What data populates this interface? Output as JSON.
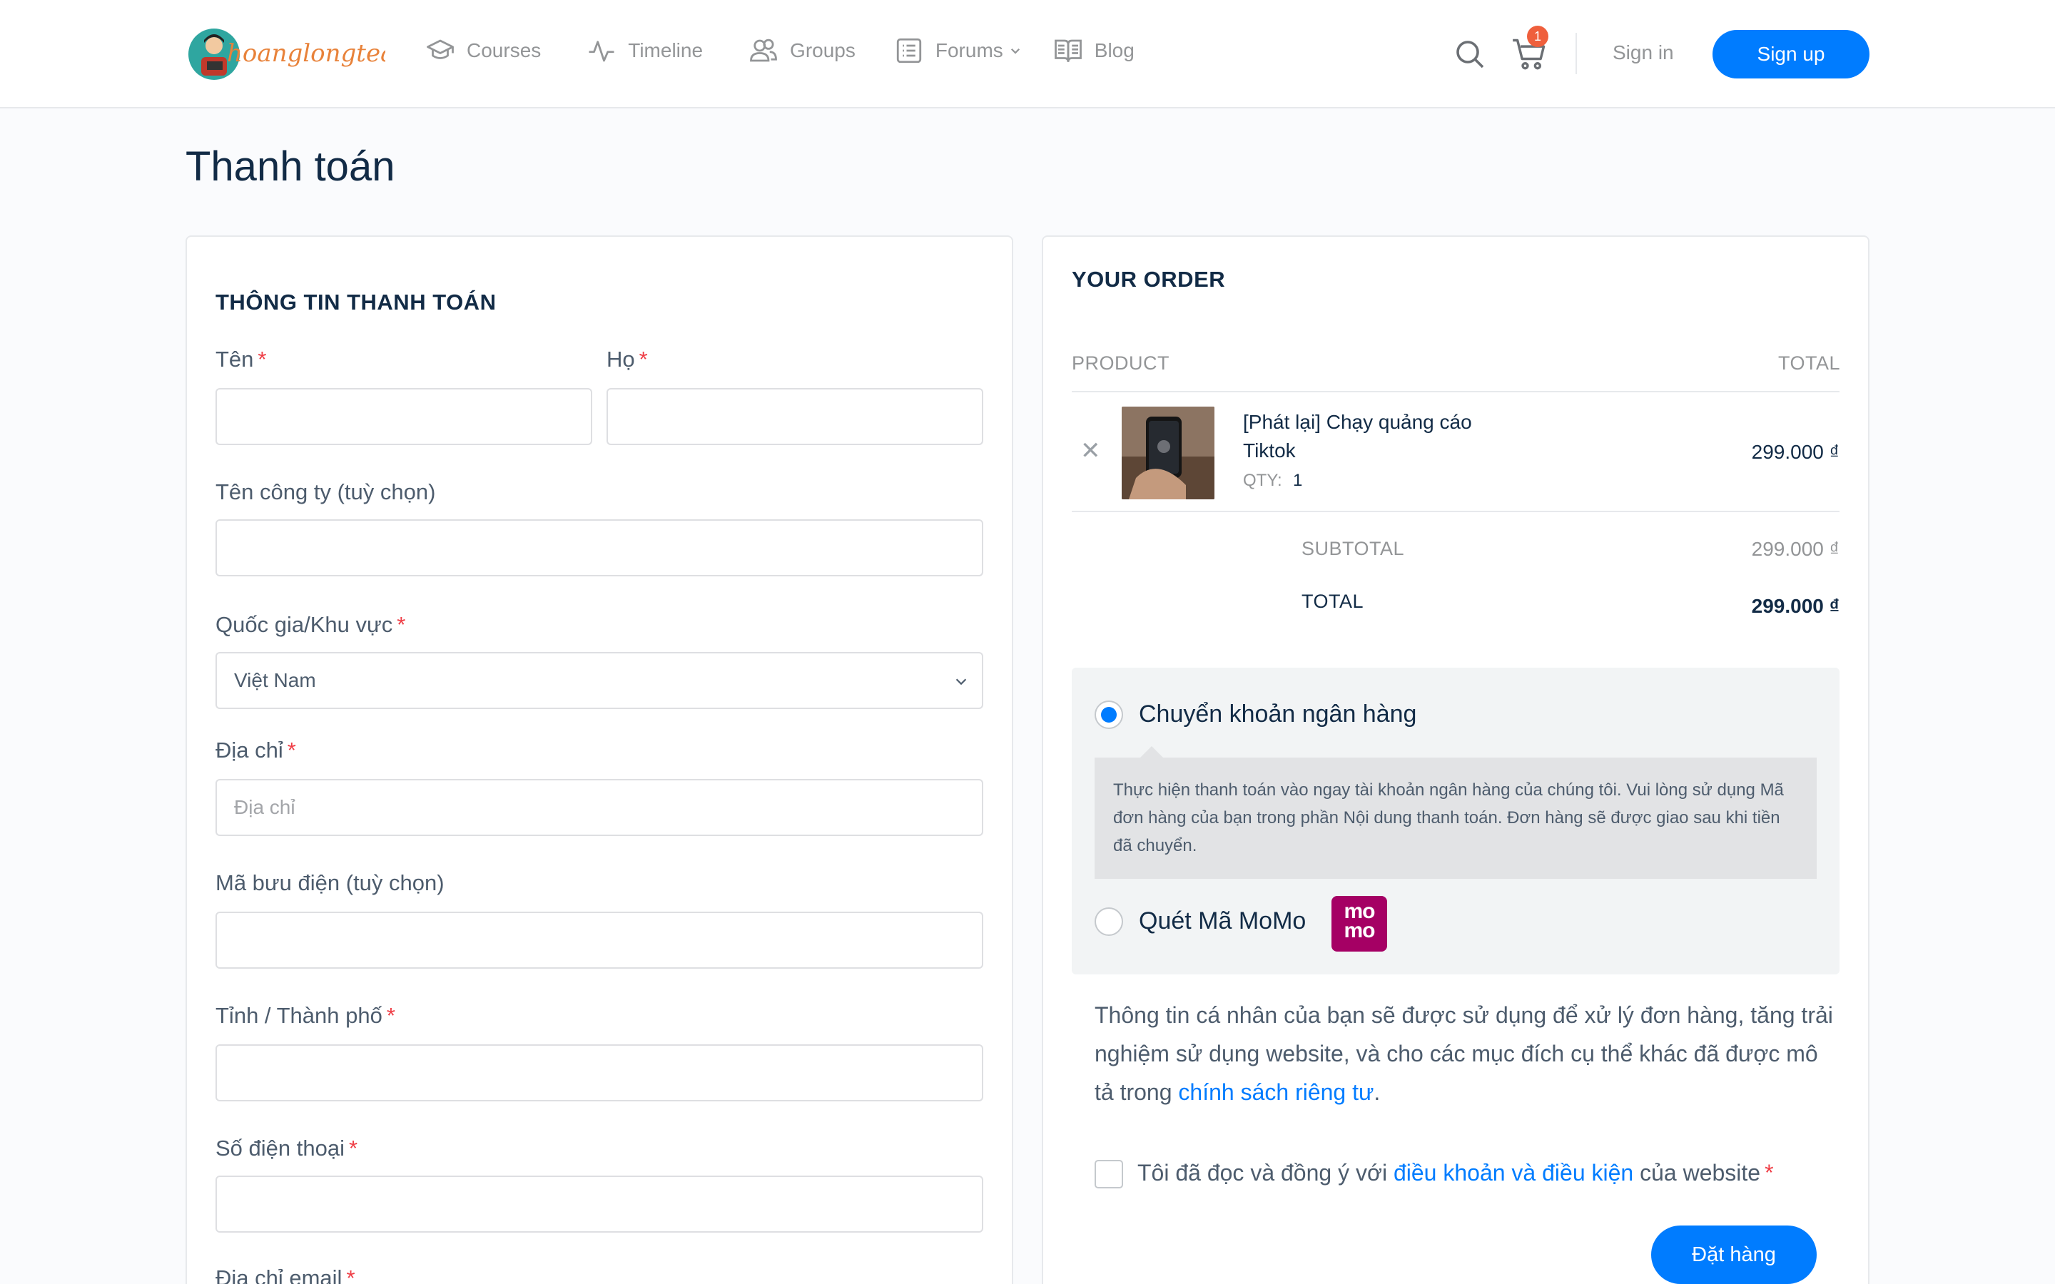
{
  "header": {
    "logo_text": "hoanglongteam",
    "nav": [
      {
        "label": "Courses",
        "icon": "graduation-cap-icon"
      },
      {
        "label": "Timeline",
        "icon": "activity-icon"
      },
      {
        "label": "Groups",
        "icon": "users-icon"
      },
      {
        "label": "Forums",
        "icon": "list-icon"
      },
      {
        "label": "Blog",
        "icon": "book-icon"
      }
    ],
    "cart_count": "1",
    "sign_in": "Sign in",
    "sign_up": "Sign up"
  },
  "page": {
    "title": "Thanh toán"
  },
  "billing": {
    "heading": "THÔNG TIN THANH TOÁN",
    "first_name_label": "Tên",
    "last_name_label": "Họ",
    "company_label": "Tên công ty (tuỳ chọn)",
    "country_label": "Quốc gia/Khu vực",
    "country_value": "Việt Nam",
    "address_label": "Địa chỉ",
    "address_placeholder": "Địa chỉ",
    "postcode_label": "Mã bưu điện (tuỳ chọn)",
    "city_label": "Tỉnh / Thành phố",
    "phone_label": "Số điện thoại",
    "email_label": "Địa chỉ email",
    "required_mark": "*"
  },
  "order": {
    "heading": "YOUR ORDER",
    "col_product": "PRODUCT",
    "col_total": "TOTAL",
    "items": [
      {
        "name": "[Phát lại] Chạy quảng cáo Tiktok",
        "qty_label": "QTY:",
        "qty": "1",
        "price": "299.000 ₫"
      }
    ],
    "subtotal_label": "SUBTOTAL",
    "subtotal_value": "299.000 ₫",
    "total_label": "TOTAL",
    "total_value": "299.000 ₫"
  },
  "payment": {
    "options": [
      {
        "label": "Chuyển khoản ngân hàng",
        "selected": true
      },
      {
        "label": "Quét Mã MoMo",
        "selected": false
      }
    ],
    "bank_description": "Thực hiện thanh toán vào ngay tài khoản ngân hàng của chúng tôi. Vui lòng sử dụng Mã đơn hàng của bạn trong phần Nội dung thanh toán. Đơn hàng sẽ được giao sau khi tiền đã chuyển.",
    "momo_logo_text": "momo"
  },
  "privacy": {
    "text_before": "Thông tin cá nhân của bạn sẽ được sử dụng để xử lý đơn hàng, tăng trải nghiệm sử dụng website, và cho các mục đích cụ thể khác đã được mô tả trong ",
    "link": "chính sách riêng tư",
    "text_after": "."
  },
  "terms": {
    "text_before": "Tôi đã đọc và đồng ý với ",
    "link": "điều khoản và điều kiện",
    "text_after": " của website",
    "required_mark": "*"
  },
  "place_order": "Đặt hàng",
  "colors": {
    "accent": "#007cff",
    "required": "#ef3e46",
    "badge": "#ef5f3c",
    "momo": "#a50064"
  }
}
